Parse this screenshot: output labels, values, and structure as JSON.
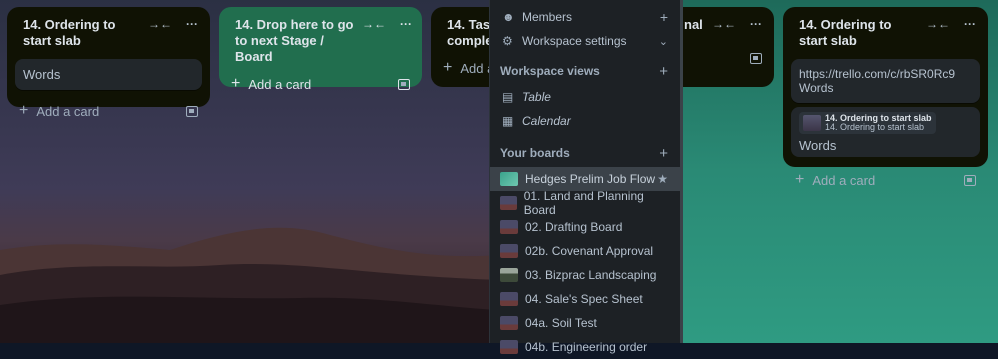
{
  "lists": [
    {
      "title": "14. Ordering to start slab",
      "cards": [
        "Words"
      ],
      "add_card": "Add a card"
    },
    {
      "title": "14. Drop here to go to next Stage / Board",
      "add_card": "Add a card"
    },
    {
      "title": "14. Tasks complete",
      "add_card": "Add a"
    },
    {
      "title_fragment": "nal"
    },
    {
      "title": "14. Ordering to start slab",
      "link_card": "https://trello.com/c/rbSR0Rc9 Words",
      "attachment_title": "14. Ordering to start slab",
      "attachment_subtitle": "14. Ordering to start slab",
      "cover_card_title": "Words",
      "add_card": "Add a card"
    }
  ],
  "sidebar": {
    "members": "Members",
    "workspace_settings": "Workspace settings",
    "workspace_views": "Workspace views",
    "views": [
      "Table",
      "Calendar"
    ],
    "your_boards": "Your boards",
    "boards": [
      "Hedges Prelim Job Flow",
      "01. Land and Planning Board",
      "02. Drafting Board",
      "02b. Covenant Approval",
      "03. Bizprac Landscaping",
      "04. Sale's Spec Sheet",
      "04a. Soil Test",
      "04b. Engineering order"
    ]
  },
  "icons": {
    "collapse": "collapse-list-icon",
    "more": "more-icon",
    "template": "card-template-icon",
    "member": "member-icon",
    "settings": "gear-icon",
    "table": "table-icon",
    "calendar": "calendar-icon",
    "star": "star-icon",
    "plus": "plus-icon",
    "chevron": "chevron-down-icon"
  },
  "colors": {
    "list_bg": "#101204",
    "list_green": "#216e4e",
    "card_bg": "#22272b",
    "sidebar_bg": "#1d2125",
    "board_active": "#3b4249"
  }
}
